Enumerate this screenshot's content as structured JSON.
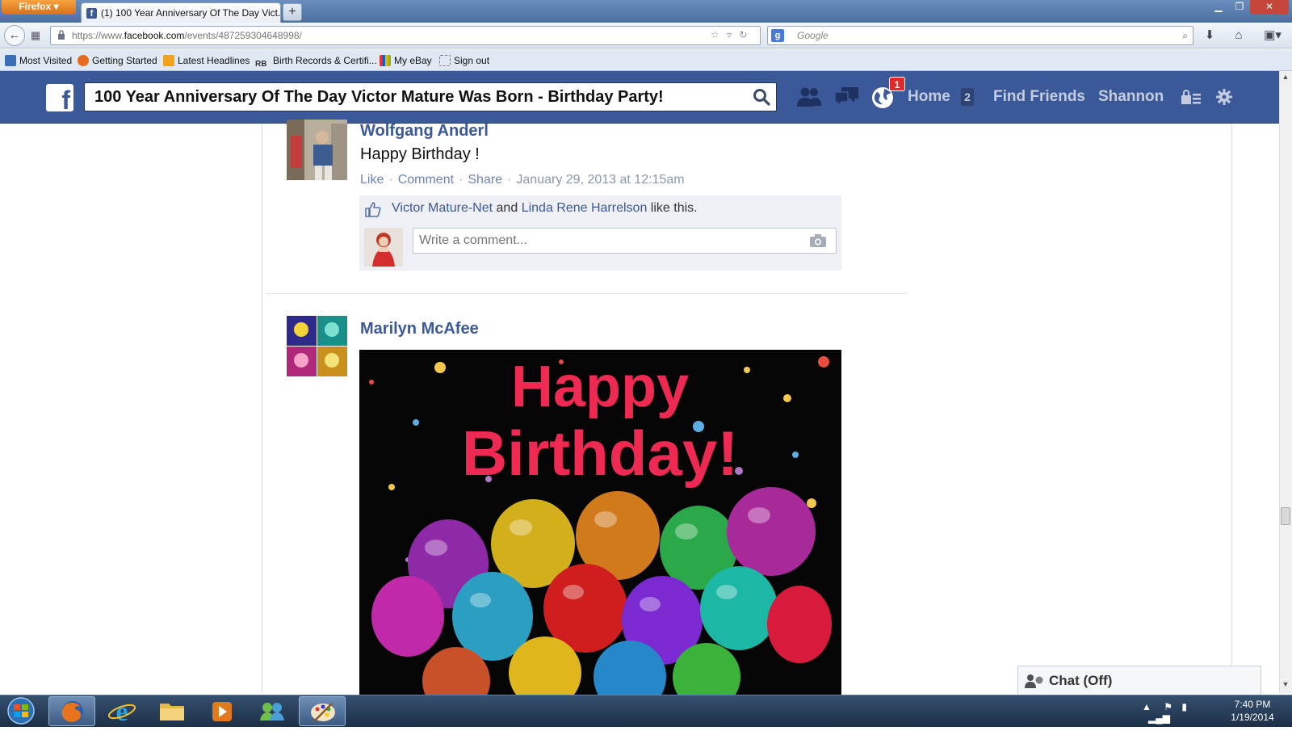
{
  "browser": {
    "app_button": "Firefox",
    "tab_title": "(1) 100 Year Anniversary Of The Day Vict...",
    "new_tab": "+",
    "url_prefix": "https://www.",
    "url_host": "facebook.com",
    "url_path": "/events/487259304648998/",
    "search_placeholder": "Google",
    "bookmarks": [
      {
        "label": "Most Visited",
        "icon_color": "#3a6fb8"
      },
      {
        "label": "Getting Started",
        "icon_color": "#e76b1e"
      },
      {
        "label": "Latest Headlines",
        "icon_color": "#f1a21b"
      },
      {
        "label": "Birth Records & Certifi...",
        "icon_color": "#ffffff"
      },
      {
        "label": "My eBay",
        "icon_color": "#d03b2b"
      },
      {
        "label": "Sign out",
        "icon_color": "#ffffff"
      }
    ]
  },
  "facebook": {
    "search_value": "100 Year Anniversary Of The Day Victor Mature Was Born - Birthday Party!",
    "notification_count": "1",
    "nav": {
      "home": "Home",
      "home_count": "2",
      "find_friends": "Find Friends",
      "profile": "Shannon"
    },
    "brand_color": "#3b5998"
  },
  "posts": [
    {
      "author": "Wolfgang Anderl",
      "text": "Happy Birthday !",
      "actions": {
        "like": "Like",
        "comment": "Comment",
        "share": "Share"
      },
      "timestamp": "January 29, 2013 at 12:15am",
      "likers": [
        "Victor Mature-Net",
        "Linda Rene Harrelson"
      ],
      "likes_and": "and",
      "likes_suffix": "like this.",
      "comment_placeholder": "Write a comment..."
    },
    {
      "author": "Marilyn McAfee",
      "image_line1": "Happy",
      "image_line2": "Birthday!"
    }
  ],
  "chat": {
    "label": "Chat (Off)"
  },
  "taskbar": {
    "time": "7:40 PM",
    "date": "1/19/2014"
  }
}
